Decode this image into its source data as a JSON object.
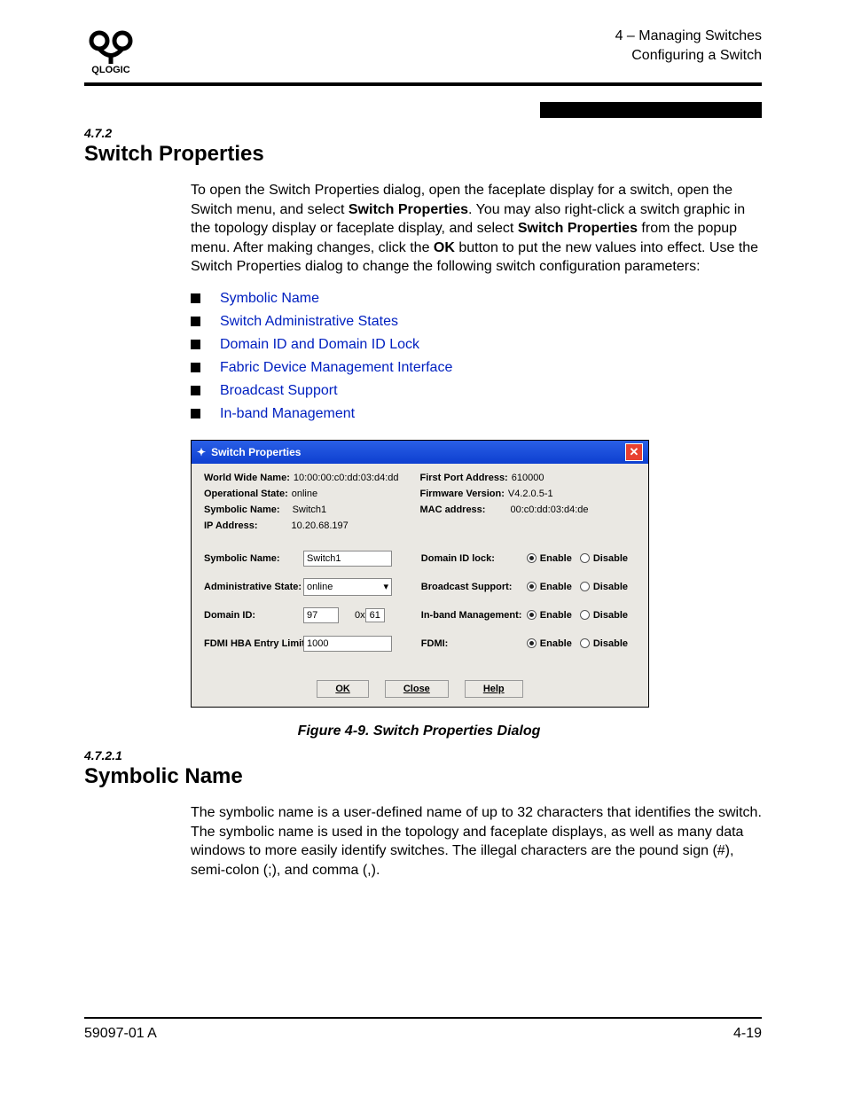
{
  "header": {
    "line1": "4 – Managing Switches",
    "line2": "Configuring a Switch"
  },
  "section1": {
    "num": "4.7.2",
    "title": "Switch Properties",
    "para_a": "To open the Switch Properties dialog, open the faceplate display for a switch, open the Switch menu, and select ",
    "bold_a": "Switch Properties",
    "para_b": ". You may also right-click a switch graphic in the topology display or faceplate display, and select ",
    "bold_b": "Switch Properties",
    "para_c": " from the popup menu. After making changes, click the ",
    "bold_c": "OK",
    "para_d": " button to put the new values into effect. Use the Switch Properties dialog to change the following switch configuration parameters:"
  },
  "bullets": [
    "Symbolic Name",
    "Switch Administrative States",
    "Domain ID and Domain ID Lock",
    "Fabric Device Management Interface",
    "Broadcast Support",
    "In-band Management"
  ],
  "dialog": {
    "title": "Switch Properties",
    "info_left": {
      "wwn_label": "World Wide Name:",
      "wwn_val": "10:00:00:c0:dd:03:d4:dd",
      "opstate_label": "Operational State:",
      "opstate_val": "online",
      "symname_label": "Symbolic Name:",
      "symname_val": "Switch1",
      "ip_label": "IP Address:",
      "ip_val": "10.20.68.197"
    },
    "info_right": {
      "fpa_label": "First Port Address:",
      "fpa_val": "610000",
      "fw_label": "Firmware Version:",
      "fw_val": "V4.2.0.5-1",
      "mac_label": "MAC address:",
      "mac_val": "00:c0:dd:03:d4:de"
    },
    "form_left": {
      "symname_label": "Symbolic Name:",
      "symname_val": "Switch1",
      "admin_label": "Administrative State:",
      "admin_val": "online",
      "domain_label": "Domain ID:",
      "domain_val": "97",
      "domain_hex_prefix": "0x",
      "domain_hex_val": "61",
      "fdmi_label": "FDMI HBA Entry Limit:",
      "fdmi_val": "1000"
    },
    "form_right": {
      "domainlock_label": "Domain ID lock:",
      "broadcast_label": "Broadcast Support:",
      "inband_label": "In-band Management:",
      "fdmi_label": "FDMI:",
      "enable": "Enable",
      "disable": "Disable"
    },
    "buttons": {
      "ok": "OK",
      "close": "Close",
      "help": "Help"
    }
  },
  "figure_caption": "Figure 4-9.  Switch Properties Dialog",
  "section2": {
    "num": "4.7.2.1",
    "title": "Symbolic Name",
    "para": "The symbolic name is a user-defined name of up to 32 characters that identifies the switch. The symbolic name is used in the topology and faceplate displays, as well as many data windows to more easily identify switches. The illegal characters are the pound sign (#), semi-colon (;), and comma (,)."
  },
  "footer": {
    "left": "59097-01 A",
    "right": "4-19"
  }
}
